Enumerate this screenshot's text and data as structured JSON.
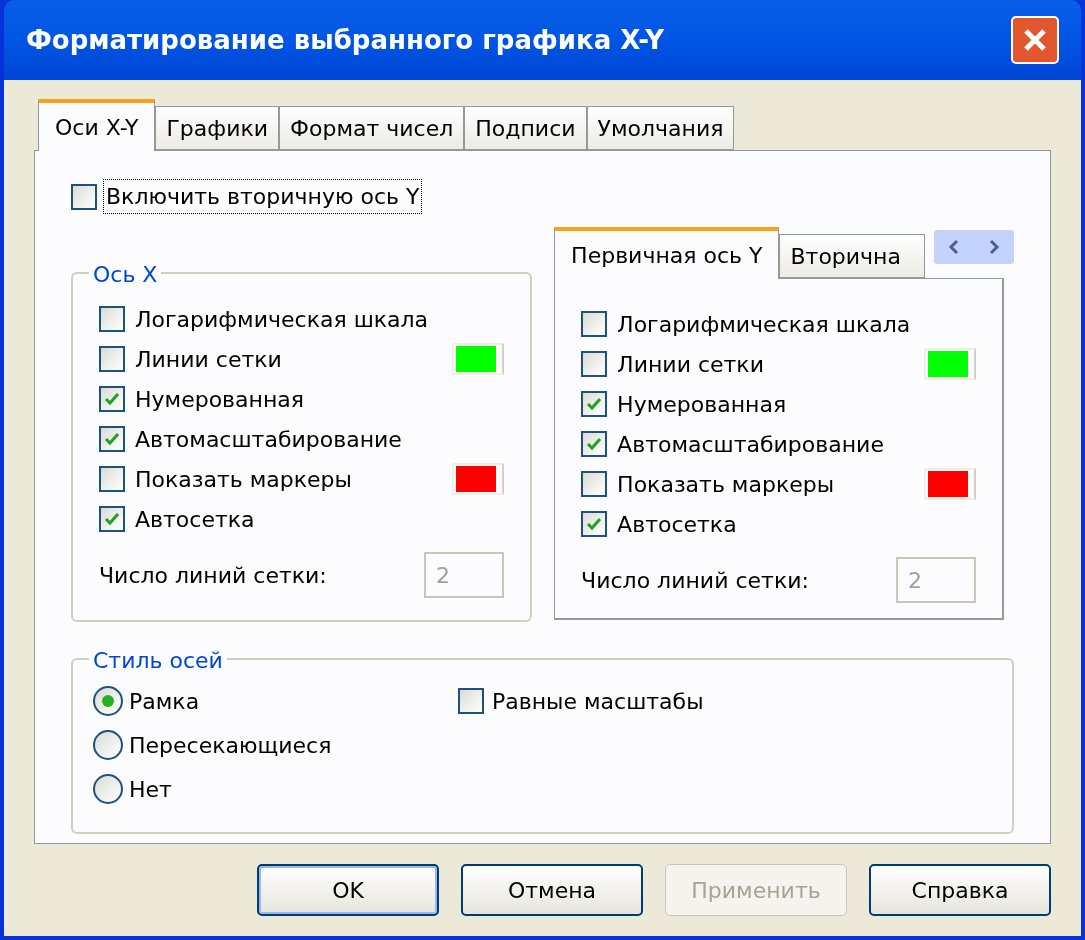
{
  "window": {
    "title": "Форматирование выбранного графика X-Y"
  },
  "tabs": [
    {
      "label": "Оси X-Y",
      "selected": true
    },
    {
      "label": "Графики",
      "selected": false
    },
    {
      "label": "Формат чисел",
      "selected": false
    },
    {
      "label": "Подписи",
      "selected": false
    },
    {
      "label": "Умолчания",
      "selected": false
    }
  ],
  "secondary_axis": {
    "label": "Включить вторичную ось Y",
    "checked": false
  },
  "axis_x": {
    "title": "Ось X",
    "options": [
      {
        "label": "Логарифмическая шкала",
        "checked": false
      },
      {
        "label": "Линии сетки",
        "checked": false,
        "color": "#00ff00"
      },
      {
        "label": "Нумерованная",
        "checked": true
      },
      {
        "label": "Автомасштабирование",
        "checked": true
      },
      {
        "label": "Показать маркеры",
        "checked": false,
        "color": "#ff0000"
      },
      {
        "label": "Автосетка",
        "checked": true
      }
    ],
    "grid_count": {
      "label": "Число линий сетки:",
      "value": "2",
      "disabled": true
    }
  },
  "axis_y": {
    "tabs": [
      {
        "label": "Первичная ось Y",
        "selected": true
      },
      {
        "label": "Вторична",
        "selected": false
      }
    ],
    "options": [
      {
        "label": "Логарифмическая шкала",
        "checked": false
      },
      {
        "label": "Линии сетки",
        "checked": false,
        "color": "#00ff00"
      },
      {
        "label": "Нумерованная",
        "checked": true
      },
      {
        "label": "Автомасштабирование",
        "checked": true
      },
      {
        "label": "Показать маркеры",
        "checked": false,
        "color": "#ff0000"
      },
      {
        "label": "Автосетка",
        "checked": true
      }
    ],
    "grid_count": {
      "label": "Число линий сетки:",
      "value": "2",
      "disabled": true
    }
  },
  "axis_style": {
    "title": "Стиль осей",
    "options": [
      {
        "label": "Рамка",
        "selected": true
      },
      {
        "label": "Пересекающиеся",
        "selected": false
      },
      {
        "label": "Нет",
        "selected": false
      }
    ],
    "equal_scales": {
      "label": "Равные масштабы",
      "checked": false
    }
  },
  "buttons": [
    {
      "label": "OK",
      "disabled": false,
      "default": true
    },
    {
      "label": "Отмена",
      "disabled": false,
      "default": false
    },
    {
      "label": "Применить",
      "disabled": true,
      "default": false
    },
    {
      "label": "Справка",
      "disabled": false,
      "default": false
    }
  ]
}
